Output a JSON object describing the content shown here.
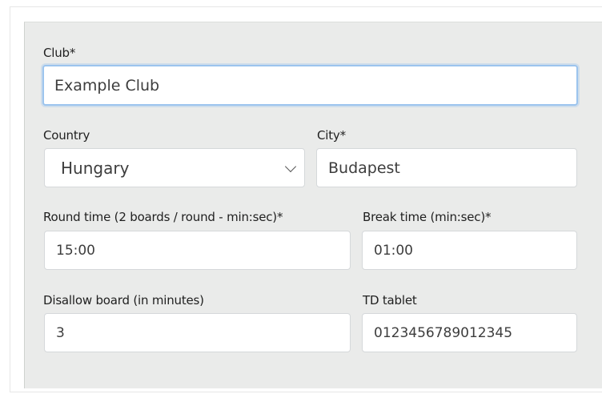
{
  "form": {
    "club": {
      "label": "Club*",
      "value": "Example Club"
    },
    "country": {
      "label": "Country",
      "selected": "Hungary"
    },
    "city": {
      "label": "City*",
      "value": "Budapest"
    },
    "round_time": {
      "label": "Round time (2 boards / round - min:sec)*",
      "value": "15:00"
    },
    "break_time": {
      "label": "Break time (min:sec)*",
      "value": "01:00"
    },
    "disallow_board": {
      "label": "Disallow board (in minutes)",
      "value": "3"
    },
    "td_tablet": {
      "label": "TD tablet",
      "value": "0123456789012345"
    }
  },
  "icons": {
    "country_dropdown": "chevron-down-icon"
  }
}
